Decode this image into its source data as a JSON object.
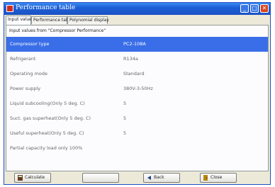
{
  "window": {
    "title": "Performance table"
  },
  "tabs": [
    {
      "label": "Input value"
    },
    {
      "label": "Performance table"
    },
    {
      "label": "Polynomial display"
    }
  ],
  "panel": {
    "subheading": "Input values from \"Compressor Performance\""
  },
  "rows": [
    {
      "label": "Compressor type",
      "value": "PC2-108A"
    },
    {
      "label": "Refrigerant",
      "value": "R134a"
    },
    {
      "label": "Operating mode",
      "value": "Standard"
    },
    {
      "label": "Power supply",
      "value": "380V-3-50Hz"
    },
    {
      "label": "Liquid subcooling(Only 5 deg. C)",
      "value": "5"
    },
    {
      "label": "Suct. gas superheat(Only 5 deg. C)",
      "value": "5"
    },
    {
      "label": "Useful superheat(Only 5 deg. C)",
      "value": "5"
    },
    {
      "label": "Partial capacity load only 100%",
      "value": ""
    }
  ],
  "buttons": {
    "calculate": "Calculate",
    "next": "",
    "back": "Back",
    "close": "Close"
  },
  "colors": {
    "titlebar": "#1d5fd6",
    "selection": "#3a6ee8",
    "close": "#d9441e"
  }
}
